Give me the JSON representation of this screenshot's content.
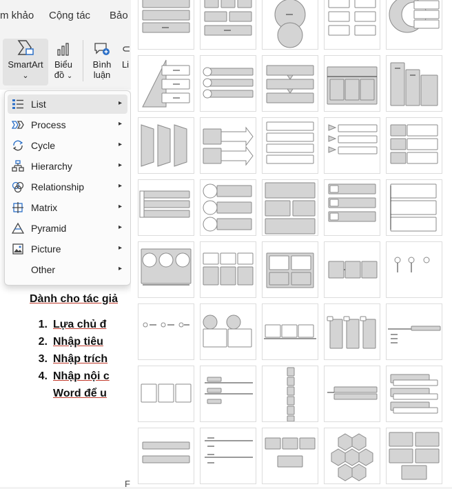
{
  "tabs": [
    "m khảo",
    "Cộng tác",
    "Bảo"
  ],
  "ribbon": {
    "smartart_label": "SmartArt",
    "bieudo_line1": "Biểu",
    "bieudo_line2": "đồ",
    "binhluan_line1": "Bình",
    "binhluan_line2": "luận",
    "cutoff_label": "Li",
    "chevron": "⌄"
  },
  "menu": {
    "items": [
      {
        "label": "List",
        "icon": "list-icon",
        "selected": true
      },
      {
        "label": "Process",
        "icon": "process-icon"
      },
      {
        "label": "Cycle",
        "icon": "cycle-icon"
      },
      {
        "label": "Hierarchy",
        "icon": "hierarchy-icon"
      },
      {
        "label": "Relationship",
        "icon": "relationship-icon"
      },
      {
        "label": "Matrix",
        "icon": "matrix-icon"
      },
      {
        "label": "Pyramid",
        "icon": "pyramid-icon"
      },
      {
        "label": "Picture",
        "icon": "picture-icon"
      },
      {
        "label": "Other",
        "icon": ""
      }
    ],
    "arrow": "▸"
  },
  "document": {
    "heading": "Dành cho tác giả",
    "items": [
      {
        "num": "1.",
        "text": "Lựa chủ đ"
      },
      {
        "num": "2.",
        "text": "Nhập tiêu"
      },
      {
        "num": "3.",
        "text": "Nhập trích"
      },
      {
        "num": "4.",
        "text": "Nhập nội c"
      },
      {
        "num": "",
        "text": "Word để u"
      }
    ],
    "footer_fragment": "F"
  },
  "gallery": {
    "layouts": [
      "blocks-stacked",
      "blocks-grid",
      "circle-venn",
      "boxes-bracketed",
      "nested-circle-list",
      "pyramid-list",
      "bullet-circle-bars",
      "stacked-arrows",
      "table-list",
      "vertical-bars",
      "chevron-process",
      "arrow-list",
      "vertical-bracket-list",
      "chevron-list",
      "stacked-box-list",
      "horizontal-bars",
      "circle-list",
      "box-grid",
      "small-box-list",
      "bracket-list",
      "photo-circles",
      "picture-grid",
      "grid-list",
      "connector-boxes",
      "pins",
      "dot-line",
      "circle-box",
      "tab-boxes",
      "tag-boxes",
      "timeline-bars",
      "table-three",
      "line-list",
      "vertical-chain",
      "arrow-bars",
      "block-list",
      "bar-list",
      "dash-list",
      "connected-boxes",
      "hexagon-cluster",
      "block-grid"
    ]
  }
}
